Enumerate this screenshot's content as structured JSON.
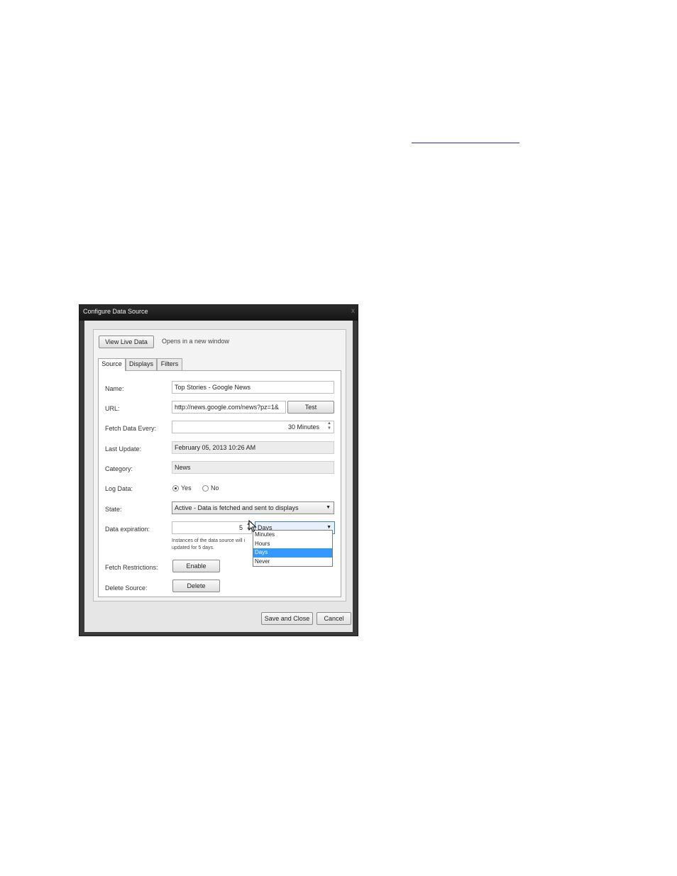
{
  "dialog": {
    "title": "Configure Data Source",
    "close_glyph": "x",
    "view_live_data_label": "View Live Data",
    "view_live_hint": "Opens in a new window",
    "tabs": [
      {
        "label": "Source",
        "active": true
      },
      {
        "label": "Displays",
        "active": false
      },
      {
        "label": "Filters",
        "active": false
      }
    ],
    "source": {
      "name_label": "Name:",
      "name_value": "Top Stories - Google News",
      "url_label": "URL:",
      "url_value": "http://news.google.com/news?pz=1&",
      "test_label": "Test",
      "fetch_label": "Fetch Data Every:",
      "fetch_value": "30 Minutes",
      "last_update_label": "Last Update:",
      "last_update_value": "February 05, 2013 10:26 AM",
      "category_label": "Category:",
      "category_value": "News",
      "log_label": "Log Data:",
      "log_yes": "Yes",
      "log_no": "No",
      "state_label": "State:",
      "state_value": "Active - Data is fetched and sent to displays",
      "expiration_label": "Data expiration:",
      "expiration_number": "5",
      "expiration_unit": "Days",
      "expiration_options": [
        "Minutes",
        "Hours",
        "Days",
        "Never"
      ],
      "expiration_note_1": "Instances of the data source will i",
      "expiration_note_2": "updated for  5 days.",
      "fetch_restrictions_label": "Fetch Restrictions:",
      "enable_label": "Enable",
      "delete_source_label": "Delete Source:",
      "delete_label": "Delete"
    },
    "save_close_label": "Save and Close",
    "cancel_label": "Cancel"
  }
}
